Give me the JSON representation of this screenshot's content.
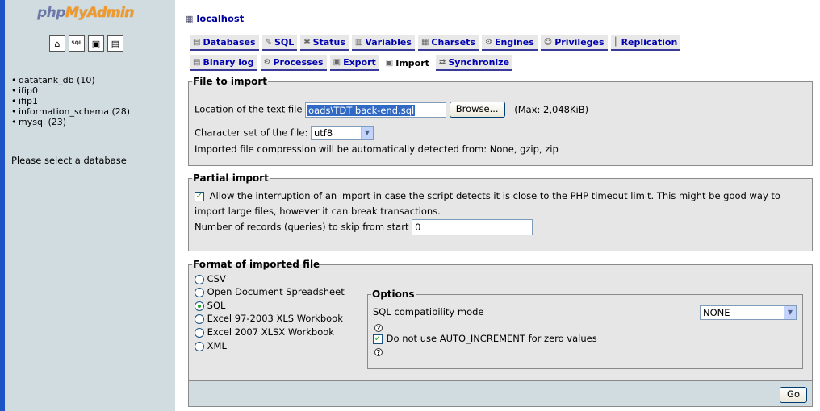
{
  "nav": {
    "logo_part1": "php",
    "logo_part2": "MyAdmin",
    "quick_icons": [
      "home-icon",
      "sql-query-icon",
      "docs-icon",
      "help-icon"
    ],
    "sql_icon_label": "SQL",
    "databases": [
      "datatank_db (10)",
      "ifip0",
      "ifip1",
      "information_schema (28)",
      "mysql (23)"
    ],
    "select_message": "Please select a database"
  },
  "server": {
    "title": "localhost"
  },
  "tabs": {
    "row1": [
      {
        "label": "Databases",
        "icon": "databases-icon"
      },
      {
        "label": "SQL",
        "icon": "sql-icon"
      },
      {
        "label": "Status",
        "icon": "status-icon"
      },
      {
        "label": "Variables",
        "icon": "variables-icon"
      },
      {
        "label": "Charsets",
        "icon": "charsets-icon"
      },
      {
        "label": "Engines",
        "icon": "engines-icon"
      },
      {
        "label": "Privileges",
        "icon": "privileges-icon"
      },
      {
        "label": "Replication",
        "icon": "replication-icon"
      }
    ],
    "row2": [
      {
        "label": "Binary log",
        "icon": "binary-log-icon"
      },
      {
        "label": "Processes",
        "icon": "processes-icon"
      },
      {
        "label": "Export",
        "icon": "export-icon"
      },
      {
        "label": "Import",
        "icon": "import-icon",
        "active": true
      },
      {
        "label": "Synchronize",
        "icon": "synchronize-icon"
      }
    ]
  },
  "file_import": {
    "legend": "File to import",
    "location_label": "Location of the text file",
    "file_value": "oads\\TDT back-end.sql",
    "browse_label": "Browse...",
    "max_size": "(Max: 2,048KiB)",
    "charset_label": "Character set of the file:",
    "charset_value": "utf8",
    "compression_note": "Imported file compression will be automatically detected from: None, gzip, zip"
  },
  "partial_import": {
    "legend": "Partial import",
    "allow_interrupt_checked": true,
    "allow_interrupt_text_1": "Allow the interruption of an import in case the script detects it is close to the PHP timeout limit. This might be good way to",
    "allow_interrupt_text_2": "import large files, however it can break transactions.",
    "skip_label": "Number of records (queries) to skip from start",
    "skip_value": "0"
  },
  "format": {
    "legend": "Format of imported file",
    "options": [
      "CSV",
      "Open Document Spreadsheet",
      "SQL",
      "Excel 97-2003 XLS Workbook",
      "Excel 2007 XLSX Workbook",
      "XML"
    ],
    "selected": "SQL",
    "options_panel": {
      "legend": "Options",
      "compat_label": "SQL compatibility mode",
      "compat_value": "NONE",
      "no_auto_increment_checked": true,
      "no_auto_increment_text": "Do not use AUTO_INCREMENT for zero values"
    }
  },
  "actions": {
    "go_label": "Go"
  },
  "colors": {
    "nav_bg": "#d0dce0",
    "nav_left_border": "#1e55c6",
    "tab_text": "#0000b0",
    "fieldset_bg": "#e6e6e6",
    "selection_blue": "#316ac5"
  }
}
